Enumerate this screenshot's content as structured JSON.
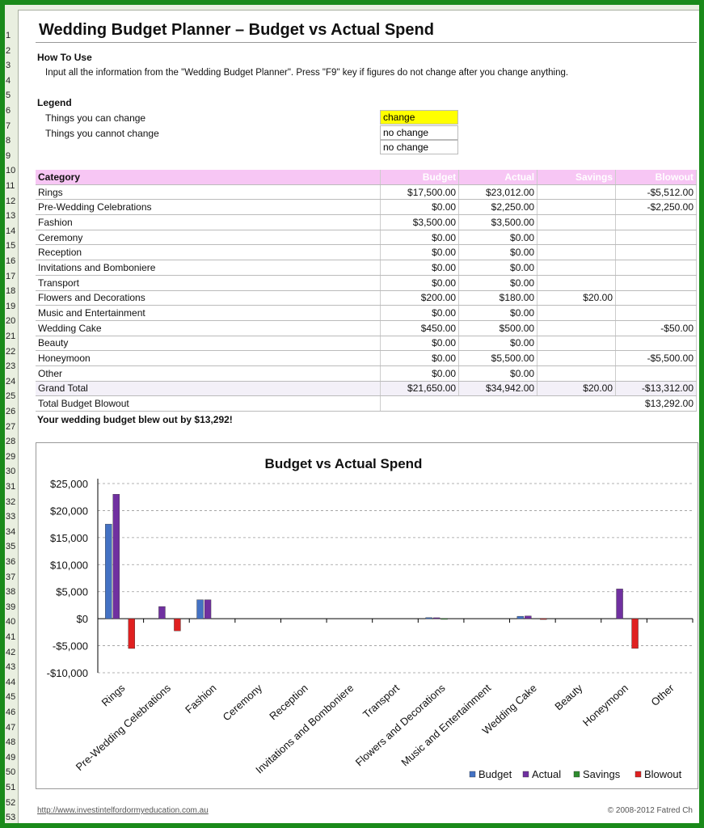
{
  "title": "Wedding Budget Planner – Budget vs Actual Spend",
  "how_to_use": {
    "heading": "How To Use",
    "text": "Input all the information from the \"Wedding Budget Planner\". Press \"F9\" key if figures do not change after you change anything."
  },
  "legend": {
    "heading": "Legend",
    "can_change_label": "Things you can change",
    "cannot_change_label": "Things you cannot change",
    "boxes": [
      "change",
      "no change",
      "no change"
    ],
    "change_color": "#ffff00"
  },
  "table": {
    "headers": [
      "Category",
      "Budget",
      "Actual",
      "Savings",
      "Blowout"
    ],
    "rows": [
      [
        "Rings",
        "$17,500.00",
        "$23,012.00",
        "",
        "-$5,512.00"
      ],
      [
        "Pre-Wedding Celebrations",
        "$0.00",
        "$2,250.00",
        "",
        "-$2,250.00"
      ],
      [
        "Fashion",
        "$3,500.00",
        "$3,500.00",
        "",
        ""
      ],
      [
        "Ceremony",
        "$0.00",
        "$0.00",
        "",
        ""
      ],
      [
        "Reception",
        "$0.00",
        "$0.00",
        "",
        ""
      ],
      [
        "Invitations and Bomboniere",
        "$0.00",
        "$0.00",
        "",
        ""
      ],
      [
        "Transport",
        "$0.00",
        "$0.00",
        "",
        ""
      ],
      [
        "Flowers and Decorations",
        "$200.00",
        "$180.00",
        "$20.00",
        ""
      ],
      [
        "Music and Entertainment",
        "$0.00",
        "$0.00",
        "",
        ""
      ],
      [
        "Wedding Cake",
        "$450.00",
        "$500.00",
        "",
        "-$50.00"
      ],
      [
        "Beauty",
        "$0.00",
        "$0.00",
        "",
        ""
      ],
      [
        "Honeymoon",
        "$0.00",
        "$5,500.00",
        "",
        "-$5,500.00"
      ],
      [
        "Other",
        "$0.00",
        "$0.00",
        "",
        ""
      ]
    ],
    "grand_total": [
      "Grand Total",
      "$21,650.00",
      "$34,942.00",
      "$20.00",
      "-$13,312.00"
    ],
    "total_blowout": [
      "Total Budget Blowout",
      "$13,292.00"
    ],
    "header_color": "#f7c6f4"
  },
  "blowout_message": "Your wedding budget blew out by $13,292!",
  "chart_data": {
    "type": "bar",
    "title": "Budget vs Actual Spend",
    "categories": [
      "Rings",
      "Pre-Wedding Celebrations",
      "Fashion",
      "Ceremony",
      "Reception",
      "Invitations and Bomboniere",
      "Transport",
      "Flowers and Decorations",
      "Music and Entertainment",
      "Wedding Cake",
      "Beauty",
      "Honeymoon",
      "Other"
    ],
    "series": [
      {
        "name": "Budget",
        "color": "#4472c4",
        "values": [
          17500,
          0,
          3500,
          0,
          0,
          0,
          0,
          200,
          0,
          450,
          0,
          0,
          0
        ]
      },
      {
        "name": "Actual",
        "color": "#7030a0",
        "values": [
          23012,
          2250,
          3500,
          0,
          0,
          0,
          0,
          180,
          0,
          500,
          0,
          5500,
          0
        ]
      },
      {
        "name": "Savings",
        "color": "#2e8b2e",
        "values": [
          0,
          0,
          0,
          0,
          0,
          0,
          0,
          20,
          0,
          0,
          0,
          0,
          0
        ]
      },
      {
        "name": "Blowout",
        "color": "#e02020",
        "values": [
          -5512,
          -2250,
          0,
          0,
          0,
          0,
          0,
          0,
          0,
          -50,
          0,
          -5500,
          0
        ]
      }
    ],
    "ylim": [
      -10000,
      25000
    ],
    "yticks": [
      25000,
      20000,
      15000,
      10000,
      5000,
      0,
      -5000,
      -10000
    ],
    "ytick_labels": [
      "$25,000",
      "$20,000",
      "$15,000",
      "$10,000",
      "$5,000",
      "$0",
      "-$5,000",
      "-$10,000"
    ],
    "grid": true,
    "legend_position": "bottom-right"
  },
  "footer": {
    "left": "http://www.investintelfordormyeducation.com.au",
    "right": "© 2008-2012 Fatred Ch"
  },
  "row_numbers": [
    "1",
    "2",
    "3",
    "4",
    "5",
    "6",
    "7",
    "8",
    "9",
    "10",
    "11",
    "12",
    "13",
    "14",
    "15",
    "16",
    "17",
    "18",
    "19",
    "20",
    "21",
    "22",
    "23",
    "24",
    "25",
    "26",
    "27",
    "28",
    "29",
    "30",
    "31",
    "32",
    "33",
    "34",
    "35",
    "36",
    "37",
    "38",
    "39",
    "40",
    "41",
    "42",
    "43",
    "44",
    "45",
    "46",
    "47",
    "48",
    "49",
    "50",
    "51",
    "52",
    "53"
  ]
}
